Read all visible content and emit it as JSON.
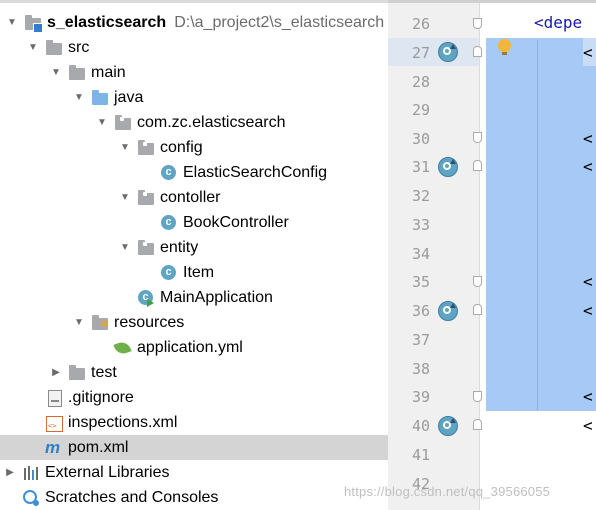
{
  "project_tree": {
    "root": {
      "name": "s_elasticsearch",
      "path": "D:\\a_project2\\s_elasticsearch"
    },
    "items": [
      {
        "label": "src"
      },
      {
        "label": "main"
      },
      {
        "label": "java"
      },
      {
        "label": "com.zc.elasticsearch"
      },
      {
        "label": "config"
      },
      {
        "label": "ElasticSearchConfig"
      },
      {
        "label": "contoller"
      },
      {
        "label": "BookController"
      },
      {
        "label": "entity"
      },
      {
        "label": "Item"
      },
      {
        "label": "MainApplication"
      },
      {
        "label": "resources"
      },
      {
        "label": "application.yml"
      },
      {
        "label": "test"
      },
      {
        "label": ".gitignore"
      },
      {
        "label": "inspections.xml"
      },
      {
        "label": "pom.xml",
        "selected": true
      },
      {
        "label": "External Libraries"
      },
      {
        "label": "Scratches and Consoles"
      }
    ]
  },
  "editor": {
    "line_numbers": [
      "26",
      "27",
      "28",
      "29",
      "30",
      "31",
      "32",
      "33",
      "34",
      "35",
      "36",
      "37",
      "38",
      "39",
      "40",
      "41",
      "42"
    ],
    "code_start": "<depe",
    "tag_open": "<",
    "highlight_color": "#a6c9f5"
  },
  "watermark": "https://blog.csdn.net/qq_39566055",
  "colors": {
    "selection": "#d4d4d4",
    "class_icon": "#5fa4c3",
    "folder": "#a7a9ac",
    "source_folder": "#7fb5e6"
  }
}
